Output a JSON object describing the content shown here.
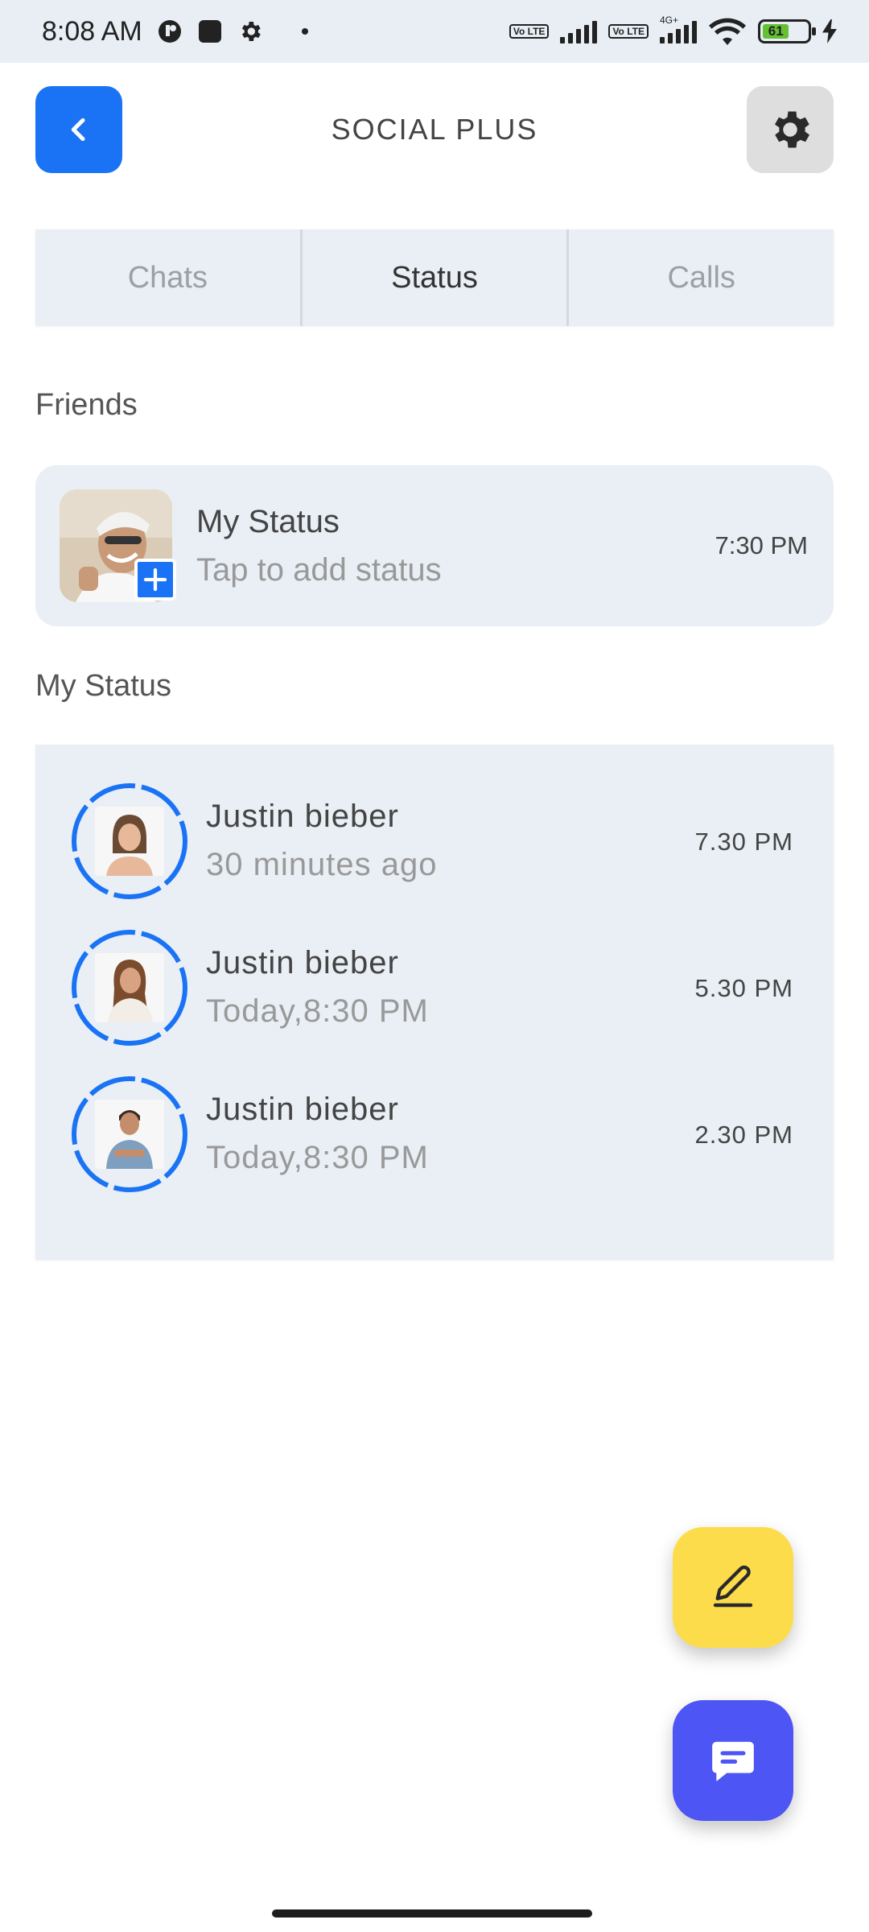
{
  "status_bar": {
    "time": "8:08 AM",
    "volte_label": "Vo LTE",
    "network_label": "4G+",
    "battery": "61",
    "icons": [
      "notification-icon",
      "app-icon",
      "gear-icon",
      "signal-icon",
      "wifi-icon",
      "battery-icon",
      "charging-icon"
    ]
  },
  "header": {
    "title": "SOCIAL PLUS",
    "back_icon": "chevron-left-icon",
    "settings_icon": "gear-icon",
    "accent": "#1a73f5"
  },
  "tabs": [
    {
      "label": "Chats",
      "active": false
    },
    {
      "label": "Status",
      "active": true
    },
    {
      "label": "Calls",
      "active": false
    }
  ],
  "sections": {
    "friends_label": "Friends",
    "my_status_label": "My Status"
  },
  "my_status": {
    "name": "My Status",
    "subtitle": "Tap to add status",
    "time": "7:30 PM",
    "badge_icon": "plus-icon"
  },
  "status_list": [
    {
      "name": "Justin bieber",
      "subtitle": "30 minutes ago",
      "time": "7.30 PM"
    },
    {
      "name": "Justin bieber",
      "subtitle": "Today,8:30 PM",
      "time": "5.30 PM"
    },
    {
      "name": "Justin bieber",
      "subtitle": "Today,8:30 PM",
      "time": "2.30 PM"
    }
  ],
  "fabs": {
    "edit_icon": "pencil-icon",
    "edit_color": "#fddc4c",
    "chat_icon": "chat-bubble-icon",
    "chat_color": "#4d55f5"
  }
}
